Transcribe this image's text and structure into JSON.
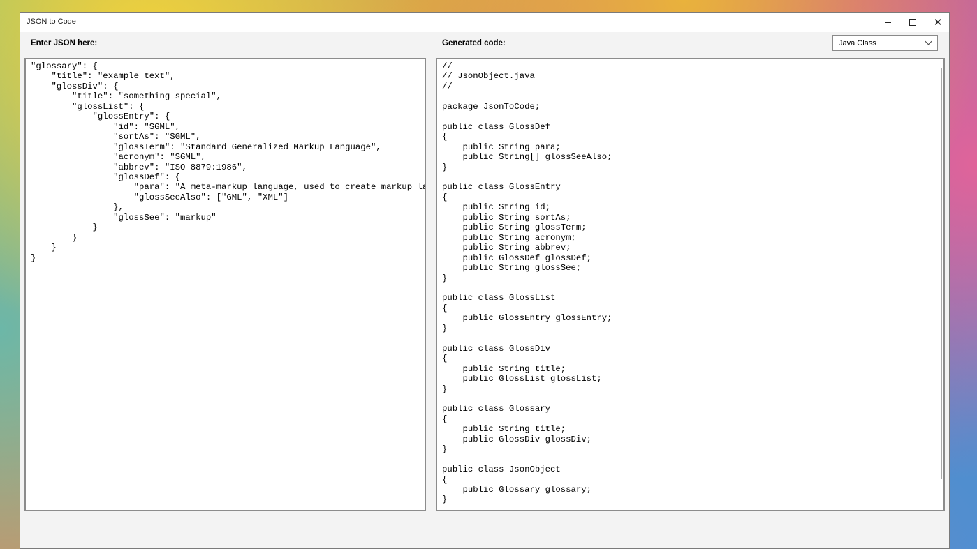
{
  "window": {
    "title": "JSON to Code"
  },
  "input_panel": {
    "label": "Enter JSON here:",
    "text": "\"glossary\": {\n    \"title\": \"example text\",\n    \"glossDiv\": {\n        \"title\": \"something special\",\n        \"glossList\": {\n            \"glossEntry\": {\n                \"id\": \"SGML\",\n                \"sortAs\": \"SGML\",\n                \"glossTerm\": \"Standard Generalized Markup Language\",\n                \"acronym\": \"SGML\",\n                \"abbrev\": \"ISO 8879:1986\",\n                \"glossDef\": {\n                    \"para\": \"A meta-markup language, used to create markup languag\n                    \"glossSeeAlso\": [\"GML\", \"XML\"]\n                },\n                \"glossSee\": \"markup\"\n            }\n        }\n    }\n}"
  },
  "output_panel": {
    "label": "Generated code:",
    "language_select": {
      "value": "Java Class"
    },
    "text": "//\n// JsonObject.java\n//\n\npackage JsonToCode;\n\npublic class GlossDef\n{\n    public String para;\n    public String[] glossSeeAlso;\n}\n\npublic class GlossEntry\n{\n    public String id;\n    public String sortAs;\n    public String glossTerm;\n    public String acronym;\n    public String abbrev;\n    public GlossDef glossDef;\n    public String glossSee;\n}\n\npublic class GlossList\n{\n    public GlossEntry glossEntry;\n}\n\npublic class GlossDiv\n{\n    public String title;\n    public GlossList glossList;\n}\n\npublic class Glossary\n{\n    public String title;\n    public GlossDiv glossDiv;\n}\n\npublic class JsonObject\n{\n    public Glossary glossary;\n}"
  },
  "icons": {
    "minimize": "minimize-icon",
    "maximize": "maximize-icon",
    "close": "close-icon",
    "dropdown": "chevron-down-icon"
  },
  "colors": {
    "window_background": "#f3f3f3",
    "panel_border": "#8c8c8c",
    "titlebar": "#ffffff"
  }
}
